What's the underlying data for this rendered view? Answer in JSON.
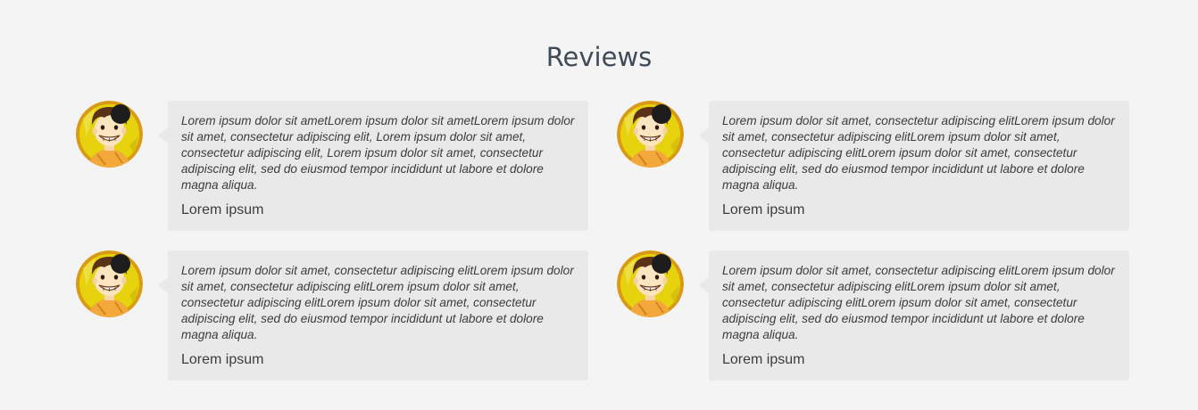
{
  "section": {
    "title": "Reviews"
  },
  "reviews": [
    {
      "text": "Lorem ipsum dolor sit ametLorem ipsum dolor sit ametLorem ipsum dolor sit amet, consectetur adipiscing elit, Lorem ipsum dolor sit amet, consectetur adipiscing elit, Lorem ipsum dolor sit amet, consectetur adipiscing elit, sed do eiusmod tempor incididunt ut labore et dolore magna aliqua.",
      "author": "Lorem ipsum",
      "avatar_icon": "cartoon-boy-avatar-icon"
    },
    {
      "text": "Lorem ipsum dolor sit amet, consectetur adipiscing elitLorem ipsum dolor sit amet, consectetur adipiscing elitLorem ipsum dolor sit amet, consectetur adipiscing elitLorem ipsum dolor sit amet, consectetur adipiscing elit, sed do eiusmod tempor incididunt ut labore et dolore magna aliqua.",
      "author": "Lorem ipsum",
      "avatar_icon": "cartoon-boy-avatar-icon"
    },
    {
      "text": "Lorem ipsum dolor sit amet, consectetur adipiscing elitLorem ipsum dolor sit amet, consectetur adipiscing elitLorem ipsum dolor sit amet, consectetur adipiscing elitLorem ipsum dolor sit amet, consectetur adipiscing elit, sed do eiusmod tempor incididunt ut labore et dolore magna aliqua.",
      "author": "Lorem ipsum",
      "avatar_icon": "cartoon-boy-avatar-icon"
    },
    {
      "text": "Lorem ipsum dolor sit amet, consectetur adipiscing elitLorem ipsum dolor sit amet, consectetur adipiscing elitLorem ipsum dolor sit amet, consectetur adipiscing elitLorem ipsum dolor sit amet, consectetur adipiscing elit, sed do eiusmod tempor incididunt ut labore et dolore magna aliqua.",
      "author": "Lorem ipsum",
      "avatar_icon": "cartoon-boy-avatar-icon"
    }
  ],
  "colors": {
    "background": "#f4f4f4",
    "bubble": "#e9e9e9",
    "title": "#3f4a57",
    "text": "#3c3c3c",
    "avatar_ring": "#d99a16",
    "avatar_fill": "#e7d20e"
  }
}
